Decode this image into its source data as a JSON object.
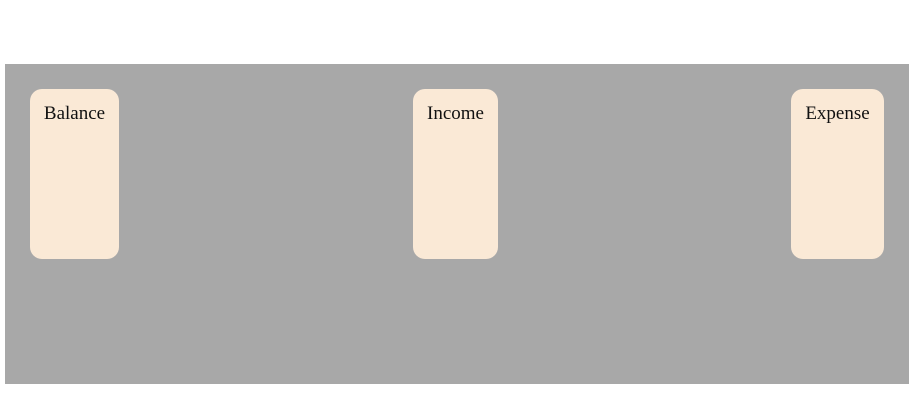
{
  "cards": {
    "balance": {
      "label": "Balance"
    },
    "income": {
      "label": "Income"
    },
    "expense": {
      "label": "Expense"
    }
  },
  "colors": {
    "page_background": "#ffffff",
    "panel_background": "#a8a8a8",
    "card_background": "#fae9d6",
    "text": "#111111"
  }
}
